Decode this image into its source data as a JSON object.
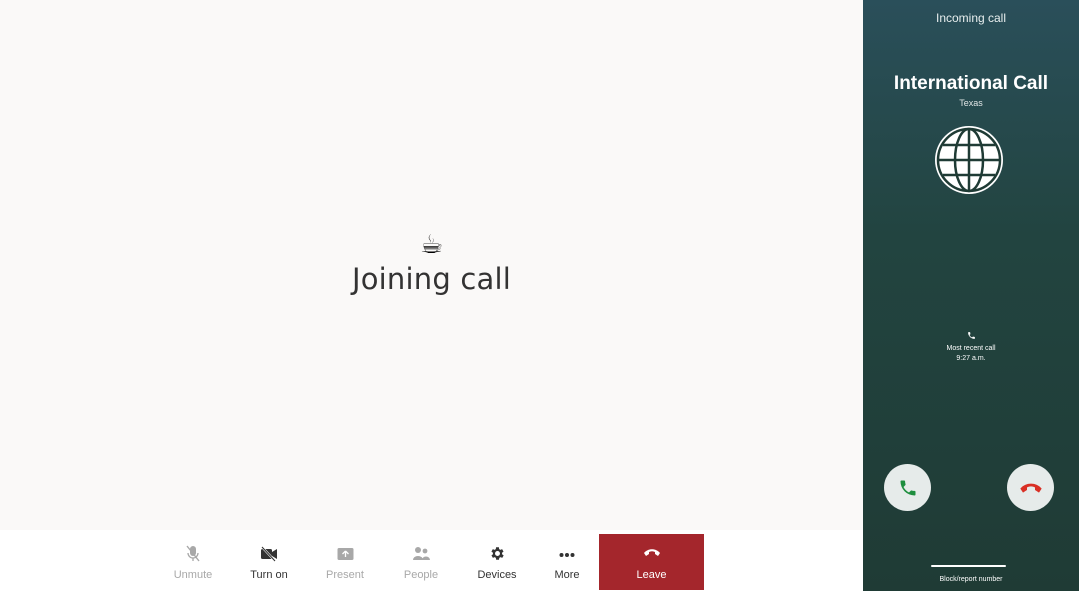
{
  "meeting": {
    "status_emoji": "☕",
    "status_text": "Joining call"
  },
  "toolbar": {
    "unmute": "Unmute",
    "turn_on": "Turn on",
    "present": "Present",
    "people": "People",
    "devices": "Devices",
    "more": "More",
    "leave": "Leave"
  },
  "phone": {
    "incoming": "Incoming call",
    "caller": "International Call",
    "location": "Texas",
    "recent_label": "Most recent call",
    "recent_time": "9:27 a.m.",
    "block_label": "Block/report number"
  },
  "colors": {
    "leave_bg": "#a4262c",
    "accept": "#1e8e3e",
    "decline": "#d93025"
  }
}
